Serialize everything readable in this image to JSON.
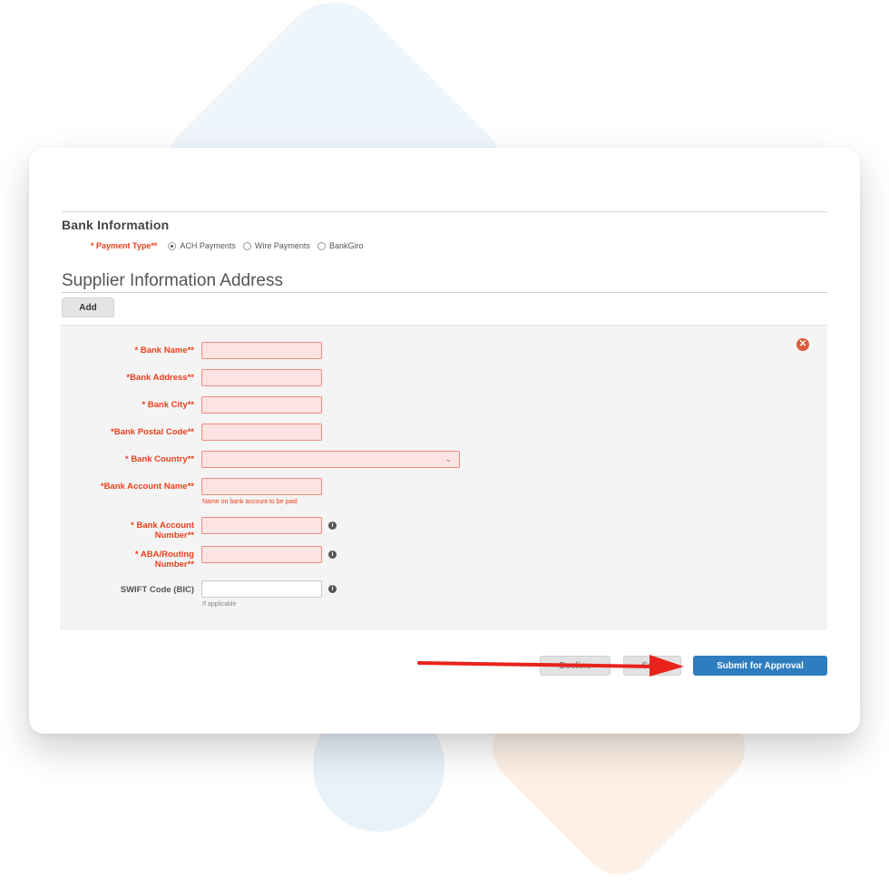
{
  "bank_section": {
    "heading": "Bank Information",
    "payment_type_label": "Payment Type**",
    "options": [
      "ACH Payments",
      "Wire Payments",
      "BankGiro"
    ],
    "selected": "ACH Payments"
  },
  "supplier_section": {
    "title": "Supplier Information Address",
    "add_label": "Add"
  },
  "fields": {
    "bank_name": "Bank Name**",
    "bank_address": "Bank Address**",
    "bank_city": "Bank City**",
    "bank_postal_code": "Bank Postal Code**",
    "bank_country": "Bank Country**",
    "bank_account_name": "Bank Account Name**",
    "bank_account_name_help": "Name on bank account to be paid",
    "bank_account_number_line1": "Bank Account",
    "bank_account_number_line2": "Number**",
    "aba_routing_line1": "ABA/Routing",
    "aba_routing_line2": "Number**",
    "swift_code": "SWIFT Code (BIC)",
    "swift_help": "If applicable",
    "required_mark": "*"
  },
  "actions": {
    "decline": "Decline",
    "save": "Save",
    "submit": "Submit for Approval"
  },
  "colors": {
    "required": "#e8401c",
    "submit_bg": "#2d7dbf",
    "invalid_bg": "#fde4e2",
    "arrow": "#e8231b"
  },
  "icons": [
    "close-icon",
    "chevron-down-icon",
    "info-icon",
    "arrow-icon"
  ]
}
